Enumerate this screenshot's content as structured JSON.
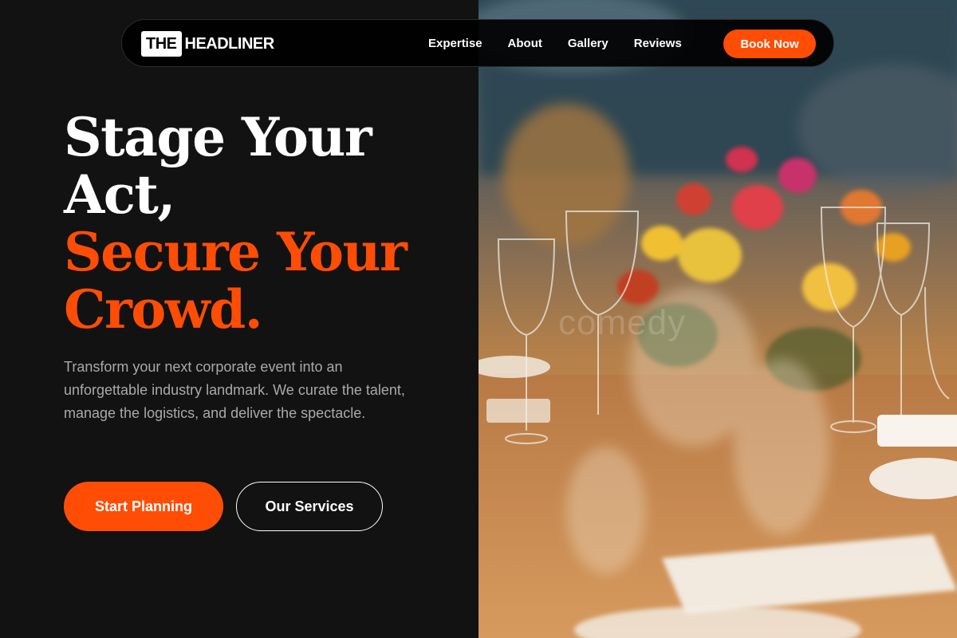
{
  "brand": {
    "logo_box": "THE",
    "logo_word": "HEADLINER"
  },
  "nav": {
    "links": [
      "Expertise",
      "About",
      "Gallery",
      "Reviews"
    ],
    "book_label": "Book Now"
  },
  "hero": {
    "headline_white_1": "Stage Your",
    "headline_white_2": "Act,",
    "headline_accent_1": "Secure Your",
    "headline_accent_2": "Crowd.",
    "lead": "Transform your next corporate event into an unforgettable industry landmark. We curate the talent, manage the logistics, and deliver the spectacle.",
    "primary_cta": "Start Planning",
    "secondary_cta": "Our Services",
    "photo_watermark": "comedy"
  },
  "colors": {
    "accent": "#ff4d05",
    "background": "#121212",
    "text_primary": "#ffffff",
    "text_muted": "#a9a9a9"
  },
  "icons": {
    "hero_image": "event-table-flowers-photo"
  }
}
